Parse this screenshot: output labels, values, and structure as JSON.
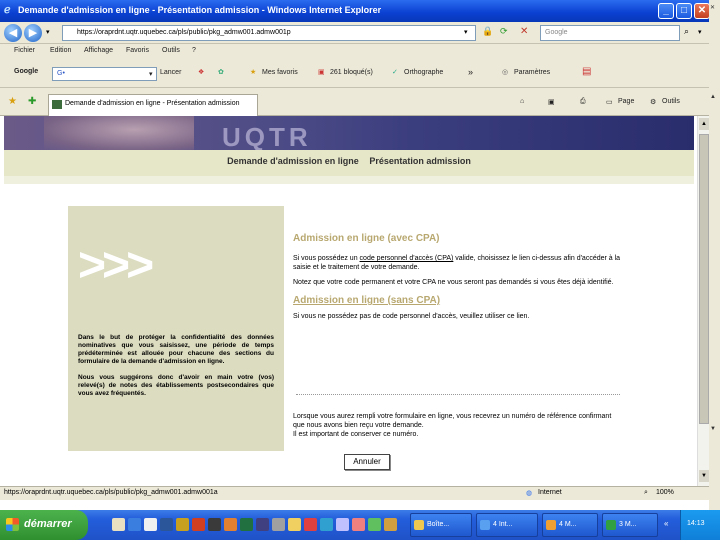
{
  "window": {
    "title": "Demande d'admission en ligne - Présentation admission - Windows Internet Explorer"
  },
  "address": {
    "url": "https://oraprdnt.uqtr.uquebec.ca/pls/public/pkg_admw001.admw001p",
    "search_placeholder": "Google"
  },
  "menu": [
    "Fichier",
    "Edition",
    "Affichage",
    "Favoris",
    "Outils",
    "?"
  ],
  "googlebar": {
    "logo": "Google",
    "field": "G•",
    "rechercher": "Lancer",
    "favoris": "Mes favoris",
    "bloques": "261 bloqué(s)",
    "orthographe": "Orthographe",
    "more": "»",
    "parametres": "Paramètres"
  },
  "tab": {
    "label": "Demande d'admission en ligne - Présentation admission",
    "page": "Page",
    "outils": "Outils"
  },
  "header": {
    "left": "Demande d'admission en ligne",
    "right": "Présentation admission"
  },
  "banner": {
    "logo": "UQTR"
  },
  "left": {
    "chevrons": ">>>",
    "p1": "Dans le but de protéger la confidentialité des données nominatives que vous saisissez, une période de temps prédéterminée est allouée pour chacune des sections du formulaire de la demande d'admission en ligne.",
    "p2": "Nous vous suggérons donc d'avoir en main votre (vos) relevé(s) de notes des établissements postsecondaires que vous avez fréquentés."
  },
  "main": {
    "link1": "Admission en ligne (avec CPA)",
    "p1a": "Si vous possédez un ",
    "p1link": "code personnel d'accès (CPA)",
    "p1b": " valide, choisissez le lien ci-dessus afin d'accéder à la saisie et le traitement de votre demande.",
    "p2": "Notez que votre code permanent et votre CPA ne vous seront pas demandés si vous êtes déjà identifié.",
    "link2": "Admission en ligne (sans CPA)",
    "p3": "Si vous ne possédez pas de code personnel d'accès, veuillez utiliser ce lien.",
    "p4": "Lorsque vous aurez rempli votre formulaire en ligne, vous recevrez un numéro de référence confirmant que nous avons bien reçu votre demande.",
    "p5": "Il est important de conserver ce numéro.",
    "cancel": "Annuler"
  },
  "status": {
    "url": "https://oraprdnt.uqtr.uquebec.ca/pls/public/pkg_admw001.admw001a",
    "zone": "Internet",
    "zoom": "100%"
  },
  "taskbar": {
    "start": "démarrer",
    "tasks": [
      "Boîte...",
      "4 Int...",
      "4 M...",
      "3 M..."
    ],
    "clock": "14:13"
  }
}
